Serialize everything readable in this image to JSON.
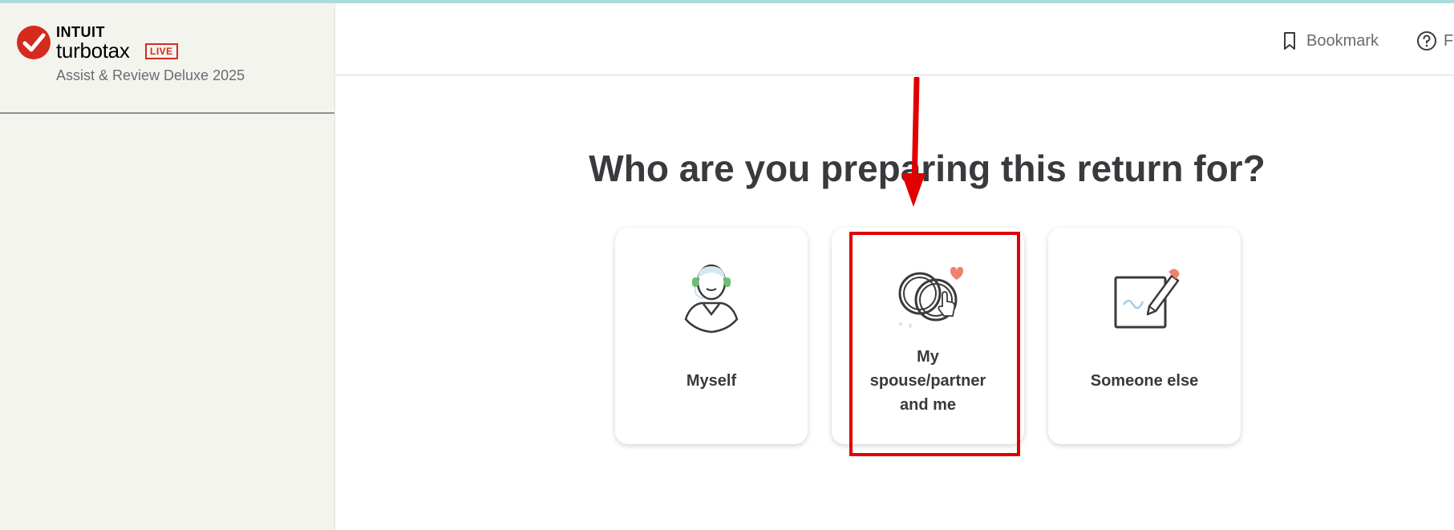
{
  "brand": {
    "company": "INTUIT",
    "product": "turbotax",
    "badge": "LIVE",
    "edition": "Assist & Review Deluxe 2025"
  },
  "header": {
    "bookmark_label": "Bookmark",
    "help_label": "F"
  },
  "main": {
    "title": "Who are you preparing this return for?",
    "options": [
      {
        "label": "Myself",
        "icon": "person-headset-icon"
      },
      {
        "label": "My spouse/partner and me",
        "icon": "wedding-rings-icon",
        "lines": [
          "My",
          "spouse/partner",
          "and me"
        ]
      },
      {
        "label": "Someone else",
        "icon": "signature-pencil-icon"
      }
    ]
  },
  "annotation": {
    "highlight_color": "#e00000"
  },
  "colors": {
    "brand_red": "#d52b1e",
    "sidebar_bg": "#f4f4ef",
    "text_dark": "#393a3d"
  }
}
